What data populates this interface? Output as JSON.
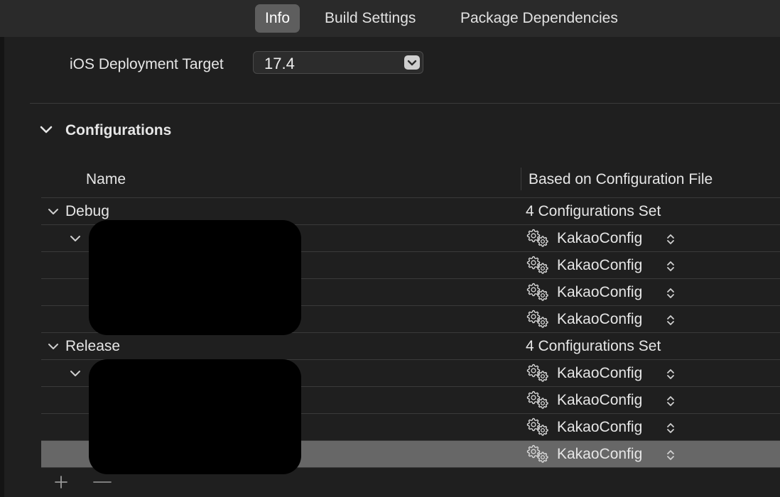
{
  "tabs": [
    {
      "label": "Info",
      "active": true
    },
    {
      "label": "Build Settings",
      "active": false
    },
    {
      "label": "Package Dependencies",
      "active": false
    }
  ],
  "deployment": {
    "label": "iOS Deployment Target",
    "value": "17.4"
  },
  "configurations": {
    "title": "Configurations",
    "columns": {
      "name": "Name",
      "based_on": "Based on Configuration File"
    },
    "groups": [
      {
        "name": "Debug",
        "summary": "4 Configurations Set",
        "files": [
          "KakaoConfig",
          "KakaoConfig",
          "KakaoConfig",
          "KakaoConfig"
        ]
      },
      {
        "name": "Release",
        "summary": "4 Configurations Set",
        "files": [
          "KakaoConfig",
          "KakaoConfig",
          "KakaoConfig",
          "KakaoConfig"
        ]
      }
    ]
  },
  "icons": {
    "gear": "gear-icon",
    "chevron": "chevron-down-icon",
    "updown": "updown-chevron-icon",
    "plus": "plus-icon",
    "minus": "minus-icon"
  },
  "colors": {
    "background": "#1f1f1f",
    "tab_active": "#5e5e5e",
    "row_selected": "#676767",
    "redaction": "#000000"
  }
}
